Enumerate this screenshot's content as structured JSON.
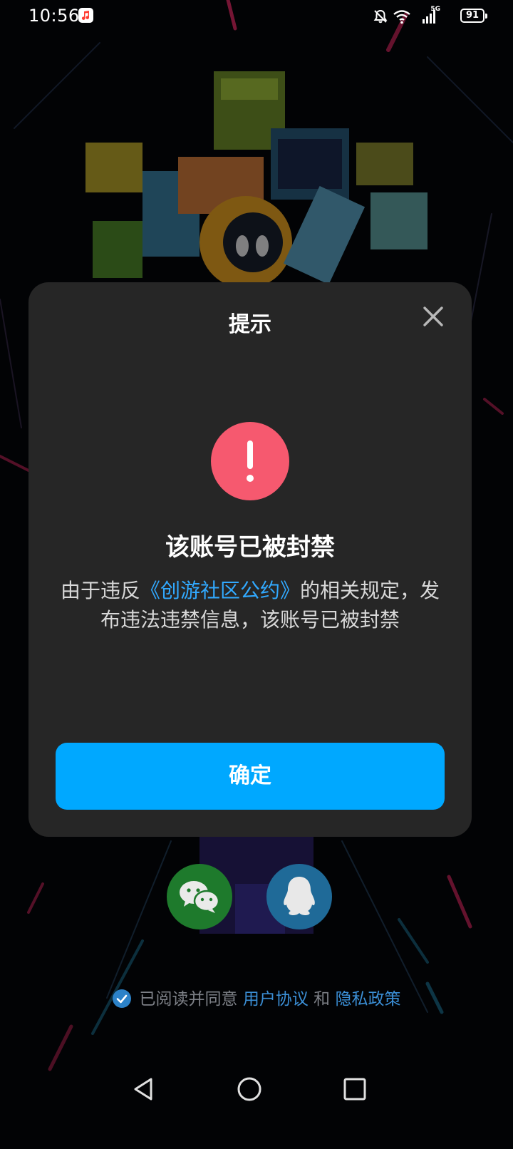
{
  "status_bar": {
    "time": "10:56",
    "network_label": "5G",
    "battery": "91"
  },
  "dialog": {
    "title": "提示",
    "heading": "该账号已被封禁",
    "message_before": "由于违反",
    "message_link": "《创游社区公约》",
    "message_after": "的相关规定，发布违法违禁信息，该账号已被封禁",
    "confirm_label": "确定"
  },
  "agreement": {
    "prefix": "已阅读并同意",
    "user_agreement": "用户协议",
    "and": "和",
    "privacy_policy": "隐私政策"
  },
  "colors": {
    "dialog_bg": "#262626",
    "accent_blue": "#00a8ff",
    "alert_red": "#f6596f",
    "wechat_green": "#1e7a2c",
    "qq_blue": "#1f6a98"
  },
  "icons": {
    "close": "close-icon",
    "alert": "exclamation-icon",
    "wechat": "wechat-icon",
    "qq": "qq-penguin-icon",
    "check": "checkmark-icon"
  }
}
